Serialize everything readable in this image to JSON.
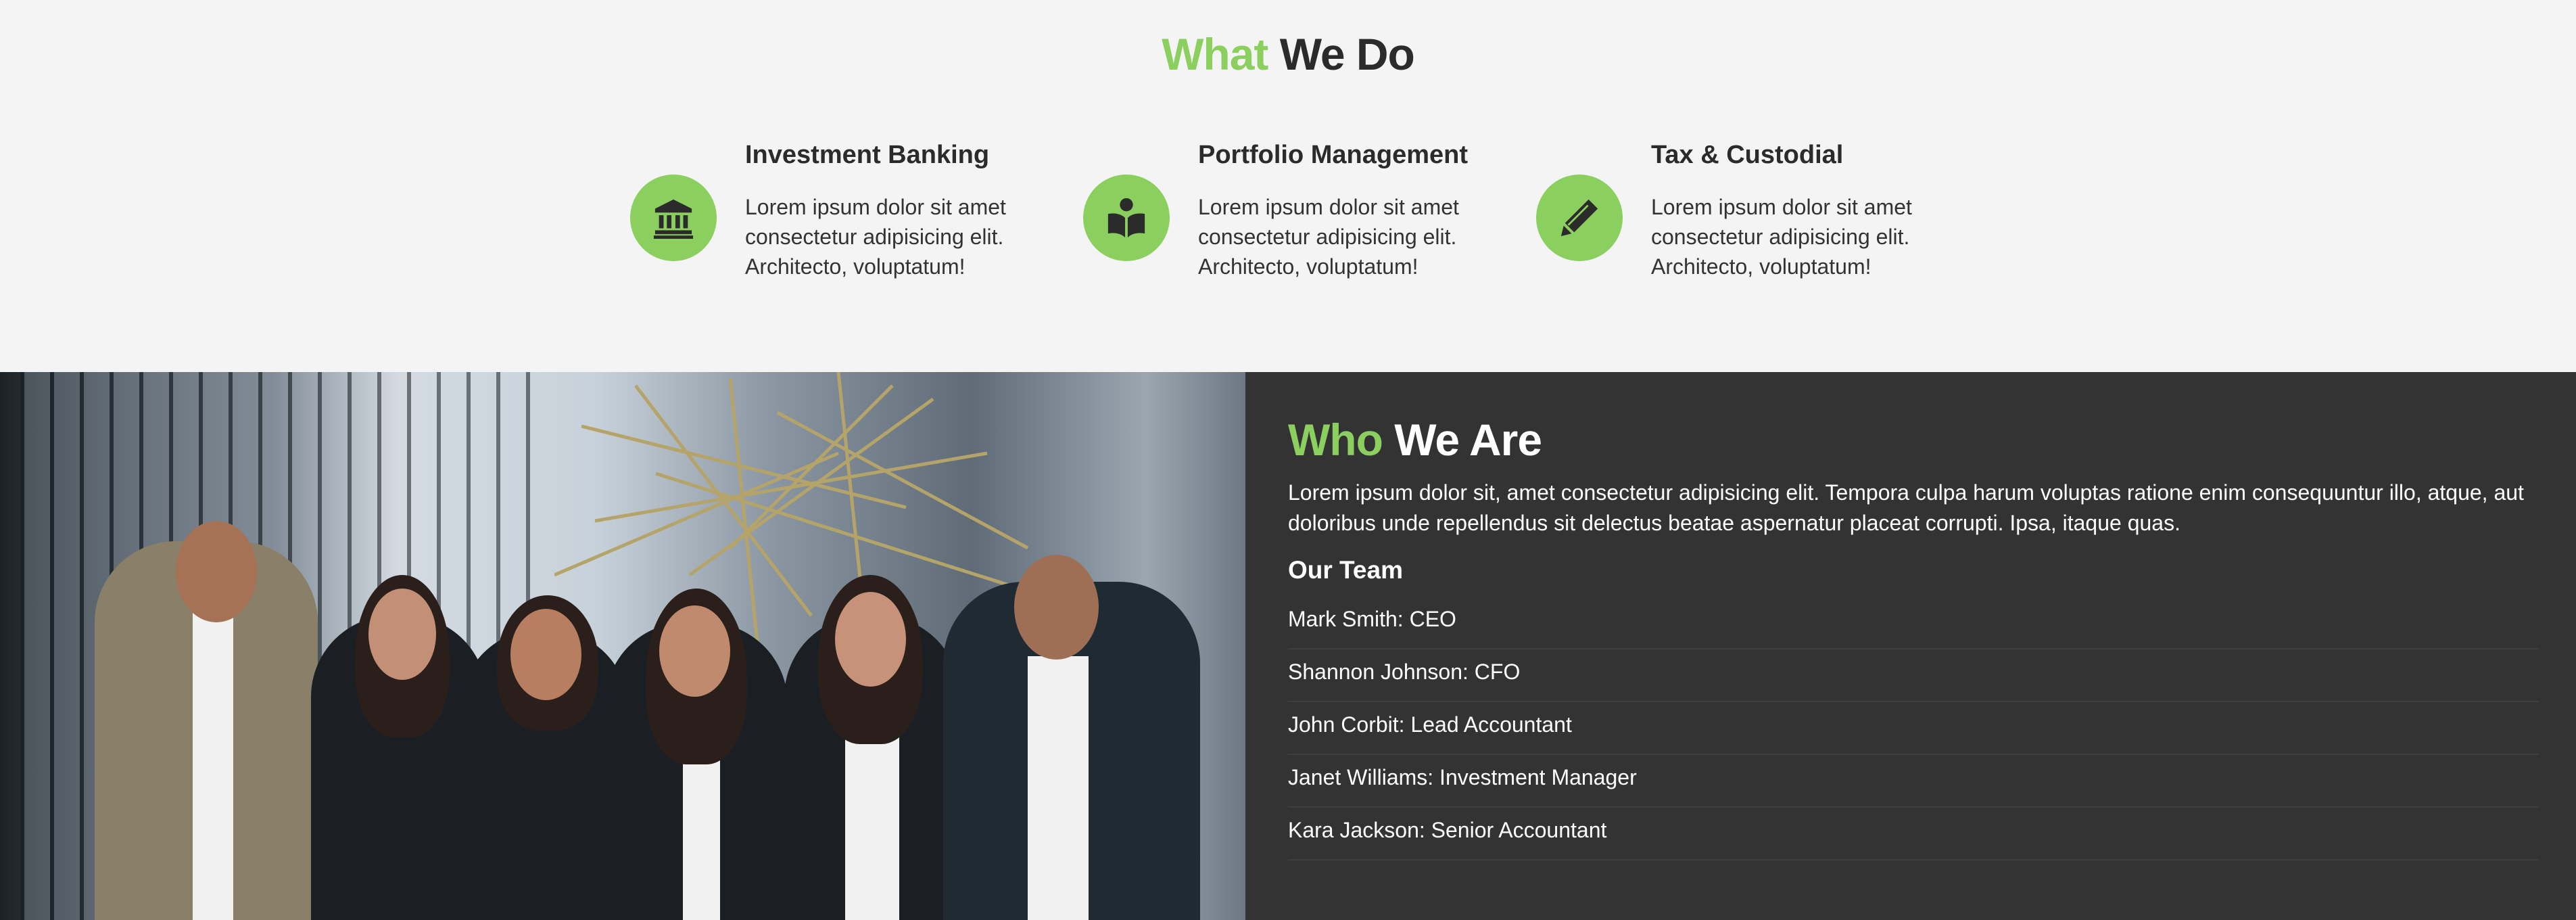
{
  "what_we_do": {
    "title_accent": "What",
    "title_rest": " We Do",
    "services": [
      {
        "icon": "bank-icon",
        "title": "Investment Banking",
        "text": "Lorem ipsum dolor sit amet consectetur adipisicing elit. Architecto, voluptatum!"
      },
      {
        "icon": "book-reader-icon",
        "title": "Portfolio Management",
        "text": "Lorem ipsum dolor sit amet consectetur adipisicing elit. Architecto, voluptatum!"
      },
      {
        "icon": "pencil-icon",
        "title": "Tax & Custodial",
        "text": "Lorem ipsum dolor sit amet consectetur adipisicing elit. Architecto, voluptatum!"
      }
    ]
  },
  "who_we_are": {
    "title_accent": "Who",
    "title_rest": " We Are",
    "intro": "Lorem ipsum dolor sit, amet consectetur adipisicing elit. Tempora culpa harum voluptas ratione enim consequuntur illo, atque, aut doloribus unde repellendus sit delectus beatae aspernatur placeat corrupti. Ipsa, itaque quas.",
    "team_heading": "Our Team",
    "team": [
      "Mark Smith: CEO",
      "Shannon Johnson: CFO",
      "John Corbit: Lead Accountant",
      "Janet Williams: Investment Manager",
      "Kara Jackson: Senior Accountant"
    ]
  },
  "colors": {
    "accent": "#8bd05f",
    "dark_bg": "#333333",
    "light_bg": "#f4f4f4"
  }
}
